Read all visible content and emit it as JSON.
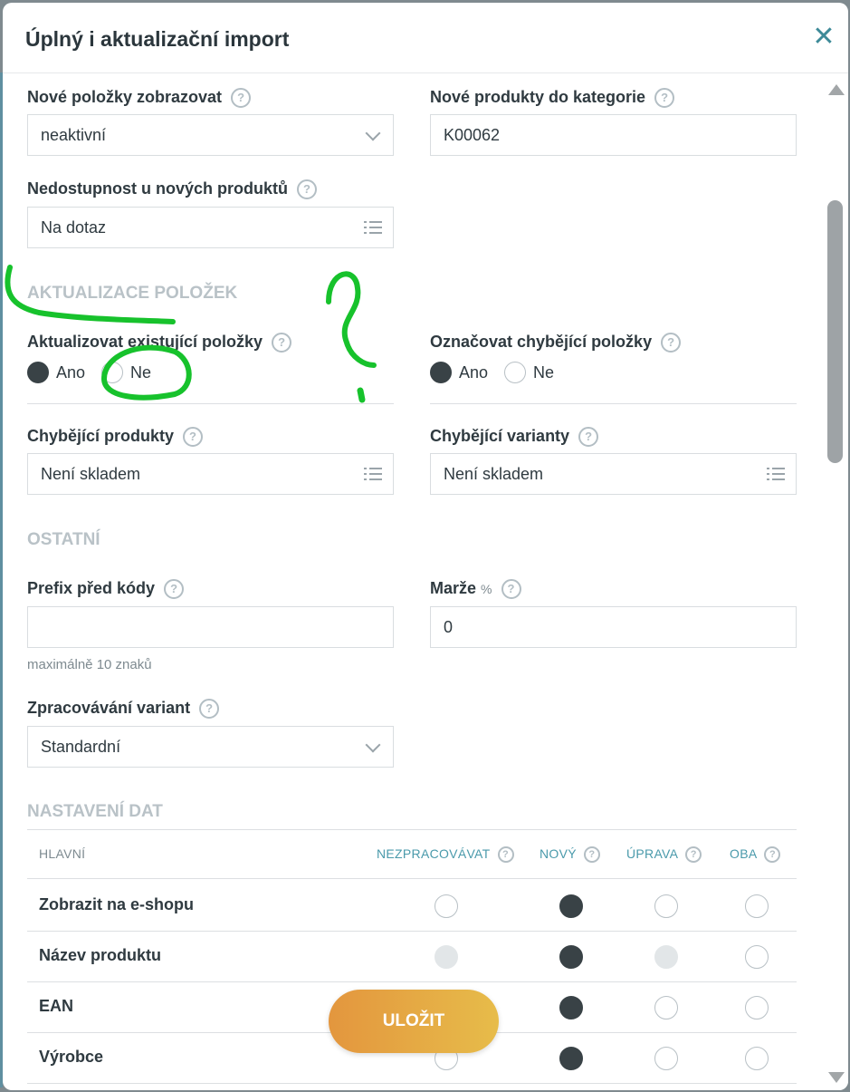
{
  "modal": {
    "title": "Úplný i aktualizační import",
    "close_icon": "close-icon"
  },
  "new_items": {
    "display_label": "Nové položky zobrazovat",
    "display_value": "neaktivní",
    "category_label": "Nové produkty do kategorie",
    "category_value": "K00062",
    "unavailability_label": "Nedostupnost u nových produktů",
    "unavailability_value": "Na dotaz"
  },
  "update_section": {
    "heading": "AKTUALIZACE POLOŽEK",
    "update_existing_label": "Aktualizovat existující položky",
    "update_existing_options": [
      "Ano",
      "Ne"
    ],
    "update_existing_selected": "Ano",
    "mark_missing_label": "Označovat chybějící položky",
    "mark_missing_options": [
      "Ano",
      "Ne"
    ],
    "mark_missing_selected": "Ano",
    "missing_products_label": "Chybějící produkty",
    "missing_products_value": "Není skladem",
    "missing_variants_label": "Chybějící varianty",
    "missing_variants_value": "Není skladem"
  },
  "other_section": {
    "heading": "OSTATNÍ",
    "prefix_label": "Prefix před kódy",
    "prefix_value": "",
    "prefix_hint": "maximálně 10 znaků",
    "margin_label": "Marže",
    "margin_unit": "%",
    "margin_value": "0",
    "variants_label": "Zpracovávání variant",
    "variants_value": "Standardní"
  },
  "data_section": {
    "heading": "NASTAVENÍ DAT",
    "columns": [
      "HLAVNÍ",
      "NEZPRACOVÁVAT",
      "NOVÝ",
      "ÚPRAVA",
      "OBA"
    ],
    "rows": [
      {
        "label": "Zobrazit na e-shopu",
        "states": [
          "off",
          "on",
          "off",
          "off"
        ]
      },
      {
        "label": "Název produktu",
        "states": [
          "disabled",
          "on",
          "disabled",
          "off"
        ]
      },
      {
        "label": "EAN",
        "states": [
          "off",
          "on",
          "off",
          "off"
        ]
      },
      {
        "label": "Výrobce",
        "states": [
          "off",
          "on",
          "off",
          "off"
        ]
      }
    ]
  },
  "footer": {
    "save_label": "ULOŽIT"
  },
  "help_icon_glyph": "?",
  "colors": {
    "accent": "#3d8a98",
    "save_gradient_start": "#e3963e",
    "save_gradient_end": "#e7bc4a",
    "radio_selected": "#394246",
    "annotation_green": "#17c22c"
  }
}
